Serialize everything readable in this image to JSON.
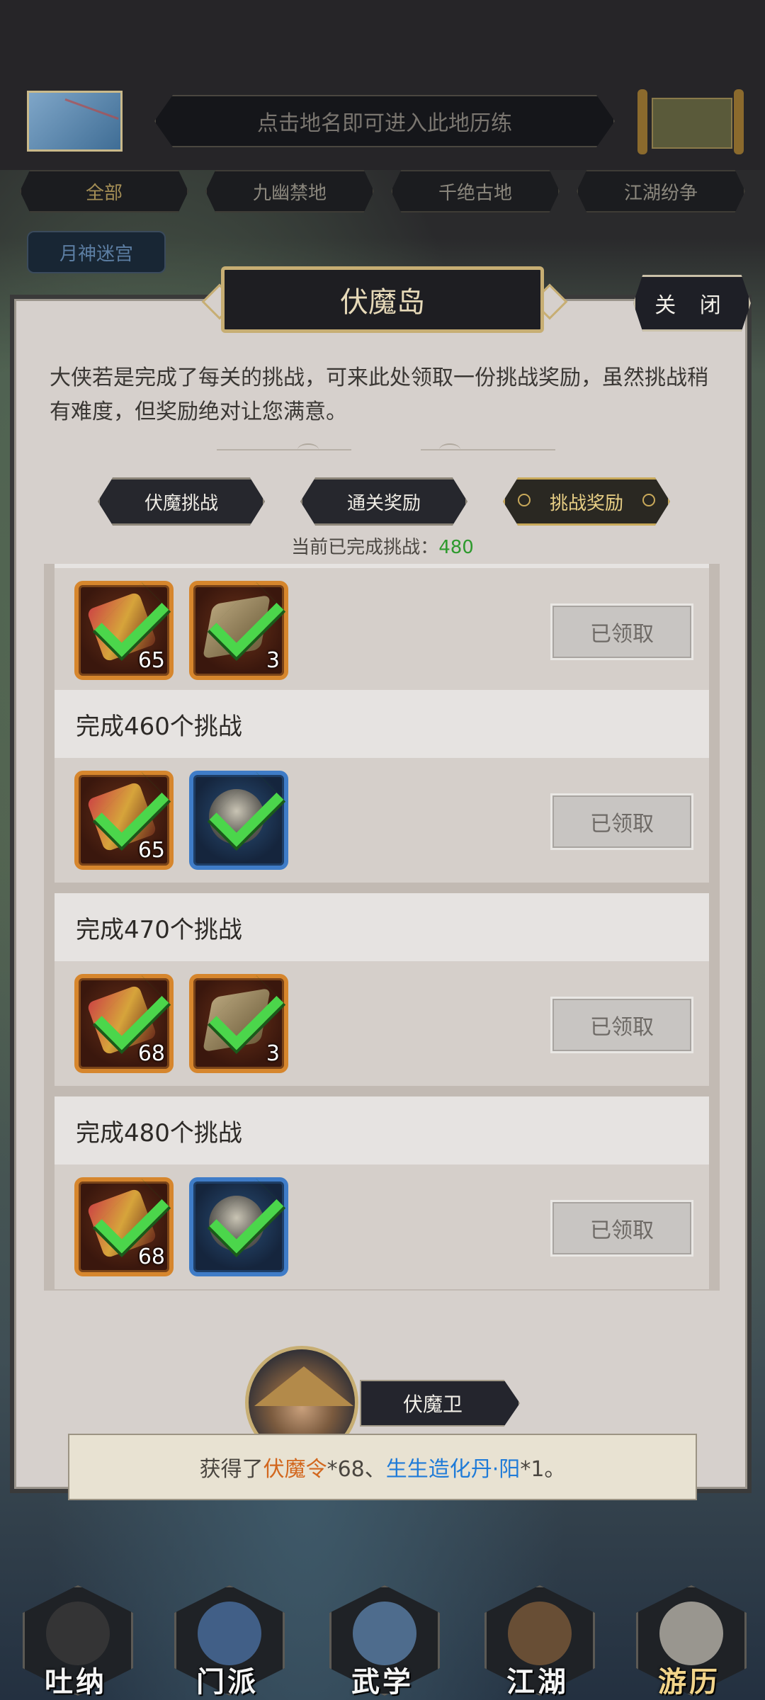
{
  "header": {
    "hint": "点击地名即可进入此地历练",
    "regions": [
      "全部",
      "九幽禁地",
      "千绝古地",
      "江湖纷争"
    ],
    "extra_region": "月神迷宫"
  },
  "dialog": {
    "title": "伏魔岛",
    "close_label": "关 闭",
    "description": "大侠若是完成了每关的挑战，可来此处领取一份挑战奖励，虽然挑战稍有难度，但奖励绝对让您满意。",
    "tabs": [
      {
        "label": "伏魔挑战",
        "active": false
      },
      {
        "label": "通关奖励",
        "active": false
      },
      {
        "label": "挑战奖励",
        "active": true
      }
    ],
    "progress_label": "当前已完成挑战：",
    "progress_value": "480",
    "rewards": [
      {
        "title": "",
        "items": [
          {
            "kind": "gold",
            "art": "token",
            "qty": "65"
          },
          {
            "kind": "gold",
            "art": "book",
            "qty": "3"
          }
        ],
        "button": "已领取"
      },
      {
        "title": "完成460个挑战",
        "items": [
          {
            "kind": "gold",
            "art": "token",
            "qty": "65"
          },
          {
            "kind": "blue",
            "art": "pill",
            "qty": ""
          }
        ],
        "button": "已领取"
      },
      {
        "title": "完成470个挑战",
        "items": [
          {
            "kind": "gold",
            "art": "token",
            "qty": "68"
          },
          {
            "kind": "gold",
            "art": "book",
            "qty": "3"
          }
        ],
        "button": "已领取"
      },
      {
        "title": "完成480个挑战",
        "items": [
          {
            "kind": "gold",
            "art": "token",
            "qty": "68"
          },
          {
            "kind": "blue",
            "art": "pill",
            "qty": ""
          }
        ],
        "button": "已领取"
      }
    ]
  },
  "npc": {
    "name": "伏魔卫"
  },
  "toast": {
    "prefix": "获得了",
    "item1": "伏魔令",
    "item1_qty": "*68、",
    "item2": "生生造化丹·阳",
    "item2_qty": "*1。"
  },
  "nav": [
    {
      "label": "吐纳",
      "icon": "meditation-icon"
    },
    {
      "label": "门派",
      "icon": "sect-icon"
    },
    {
      "label": "武学",
      "icon": "martial-arts-icon"
    },
    {
      "label": "江湖",
      "icon": "jianghu-icon"
    },
    {
      "label": "游历",
      "icon": "travel-icon",
      "active": true
    }
  ],
  "colors": {
    "progress": "#2e9a2e",
    "item1": "#d2671e",
    "item2": "#1f7bd8",
    "gold_frame": "#d6862d",
    "blue_frame": "#3f7cc7"
  }
}
